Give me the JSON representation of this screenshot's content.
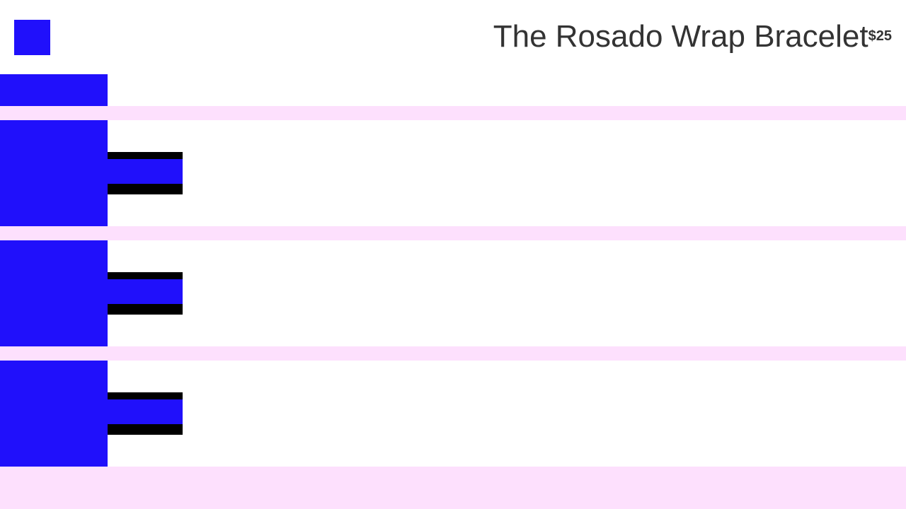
{
  "header": {
    "logo_icon": "brand-logo-icon",
    "title": "The Rosado Wrap Bracelet",
    "price": "$25"
  },
  "colors": {
    "accent": "#2010fb",
    "page_background": "#fde0fd",
    "surface": "#ffffff",
    "text": "#333333",
    "control_border": "#000000"
  },
  "gallery": {
    "thumbnail_icon": "product-thumbnail-icon"
  },
  "items": [
    {
      "image_icon": "product-image-icon",
      "control_icon": "option-button-icon"
    },
    {
      "image_icon": "product-image-icon",
      "control_icon": "option-button-icon"
    },
    {
      "image_icon": "product-image-icon",
      "control_icon": "option-button-icon"
    }
  ]
}
